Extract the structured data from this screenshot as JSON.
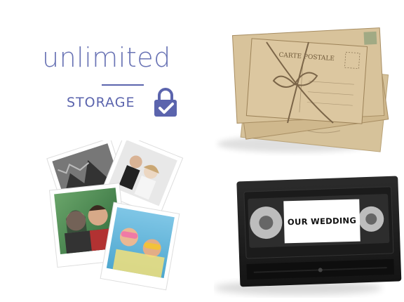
{
  "logo": {
    "word": "unlimited",
    "subword": "STORAGE",
    "icon": "lock-check-icon",
    "color": "#5b64ad"
  },
  "letters": {
    "stamp_text": "CARTE POSTALE"
  },
  "vhs": {
    "label": "OUR WEDDING"
  },
  "photos": {
    "count": 4
  }
}
